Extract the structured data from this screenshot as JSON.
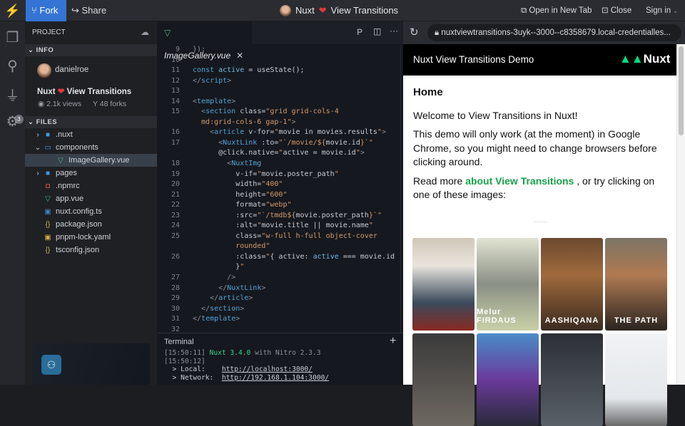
{
  "topbar": {
    "fork": "Fork",
    "share": "Share",
    "title": "Nuxt",
    "title_suffix": "View Transitions",
    "open_new_tab": "Open in New Tab",
    "close": "Close",
    "sign_in": "Sign in"
  },
  "activity": {
    "badge": "3"
  },
  "sidebar": {
    "project": "PROJECT",
    "info": "INFO",
    "user": "danielroe",
    "project_name": "Nuxt",
    "project_name_suffix": "View Transitions",
    "views": "2.1k views",
    "forks": "48 forks",
    "files_header": "FILES",
    "files": [
      {
        "name": ".nuxt",
        "icon": "folder-icon",
        "chev": "›"
      },
      {
        "name": "components",
        "icon": "folder-open-icon",
        "chev": "⌄"
      },
      {
        "name": "ImageGallery.vue",
        "icon": "vue-icon",
        "chev": ""
      },
      {
        "name": "pages",
        "icon": "folder-icon",
        "chev": "›"
      },
      {
        "name": ".npmrc",
        "icon": "npm-icon",
        "chev": ""
      },
      {
        "name": "app.vue",
        "icon": "vue-icon",
        "chev": ""
      },
      {
        "name": "nuxt.config.ts",
        "icon": "typescript-icon",
        "chev": ""
      },
      {
        "name": "package.json",
        "icon": "json-icon",
        "chev": ""
      },
      {
        "name": "pnpm-lock.yaml",
        "icon": "yaml-icon",
        "chev": ""
      },
      {
        "name": "tsconfig.json",
        "icon": "json-icon",
        "chev": ""
      }
    ]
  },
  "editor": {
    "tab": "ImageGallery.vue",
    "lines": [
      {
        "n": "9",
        "t": [
          [
            "p",
            "});"
          ]
        ]
      },
      {
        "n": "10",
        "t": []
      },
      {
        "n": "11",
        "t": [
          [
            "kw",
            "const "
          ],
          [
            "var",
            "active"
          ],
          [
            "id",
            " = useState();"
          ]
        ]
      },
      {
        "n": "12",
        "t": [
          [
            "p",
            "</"
          ],
          [
            "tag",
            "script"
          ],
          [
            "p",
            ">"
          ]
        ]
      },
      {
        "n": "13",
        "t": []
      },
      {
        "n": "14",
        "t": [
          [
            "p",
            "<"
          ],
          [
            "tag",
            "template"
          ],
          [
            "p",
            ">"
          ]
        ]
      },
      {
        "n": "15",
        "t": [
          [
            "p",
            "  <"
          ],
          [
            "tag",
            "section "
          ],
          [
            "attr",
            "class="
          ],
          [
            "str",
            "\"grid grid-cols-4"
          ]
        ]
      },
      {
        "n": "",
        "t": [
          [
            "str",
            "  md:grid-cols-6 gap-1\""
          ],
          [
            "p",
            ">"
          ]
        ]
      },
      {
        "n": "16",
        "t": [
          [
            "p",
            "    <"
          ],
          [
            "tag",
            "article "
          ],
          [
            "attr",
            "v-for="
          ],
          [
            "str",
            "\""
          ],
          [
            "id",
            "movie in movies.results"
          ],
          [
            "str",
            "\""
          ],
          [
            "p",
            ">"
          ]
        ]
      },
      {
        "n": "17",
        "t": [
          [
            "p",
            "      <"
          ],
          [
            "tag",
            "NuxtLink "
          ],
          [
            "attr",
            ":to="
          ],
          [
            "str",
            "\"`/movie/${"
          ],
          [
            "id",
            "movie.id"
          ],
          [
            "str",
            "}`\""
          ]
        ]
      },
      {
        "n": "",
        "t": [
          [
            "attr",
            "      @click.native="
          ],
          [
            "str",
            "\""
          ],
          [
            "id",
            "active = movie.id"
          ],
          [
            "str",
            "\""
          ],
          [
            "p",
            ">"
          ]
        ]
      },
      {
        "n": "18",
        "t": [
          [
            "p",
            "        <"
          ],
          [
            "tag",
            "NuxtImg"
          ]
        ]
      },
      {
        "n": "19",
        "t": [
          [
            "attr",
            "          v-if="
          ],
          [
            "str",
            "\""
          ],
          [
            "id",
            "movie.poster_path"
          ],
          [
            "str",
            "\""
          ]
        ]
      },
      {
        "n": "20",
        "t": [
          [
            "attr",
            "          width="
          ],
          [
            "str",
            "\"400\""
          ]
        ]
      },
      {
        "n": "21",
        "t": [
          [
            "attr",
            "          height="
          ],
          [
            "str",
            "\"600\""
          ]
        ]
      },
      {
        "n": "22",
        "t": [
          [
            "attr",
            "          format="
          ],
          [
            "str",
            "\"webp\""
          ]
        ]
      },
      {
        "n": "23",
        "t": [
          [
            "attr",
            "          :src="
          ],
          [
            "str",
            "\"`/tmdb${"
          ],
          [
            "id",
            "movie.poster_path"
          ],
          [
            "str",
            "}`\""
          ]
        ]
      },
      {
        "n": "24",
        "t": [
          [
            "attr",
            "          :alt="
          ],
          [
            "str",
            "\""
          ],
          [
            "id",
            "movie.title || movie.name"
          ],
          [
            "str",
            "\""
          ]
        ]
      },
      {
        "n": "25",
        "t": [
          [
            "attr",
            "          class="
          ],
          [
            "str",
            "\"w-full h-full object-cover"
          ]
        ]
      },
      {
        "n": "",
        "t": [
          [
            "str",
            "          rounded\""
          ]
        ]
      },
      {
        "n": "26",
        "t": [
          [
            "attr",
            "          :class="
          ],
          [
            "str",
            "\""
          ],
          [
            "id",
            "{ active: "
          ],
          [
            "var",
            "active"
          ],
          [
            "id",
            " === movie.id"
          ]
        ]
      },
      {
        "n": "",
        "t": [
          [
            "id",
            "          }"
          ],
          [
            "str",
            "\""
          ]
        ]
      },
      {
        "n": "27",
        "t": [
          [
            "p",
            "        />"
          ]
        ]
      },
      {
        "n": "28",
        "t": [
          [
            "p",
            "      </"
          ],
          [
            "tag",
            "NuxtLink"
          ],
          [
            "p",
            ">"
          ]
        ]
      },
      {
        "n": "29",
        "t": [
          [
            "p",
            "    </"
          ],
          [
            "tag",
            "article"
          ],
          [
            "p",
            ">"
          ]
        ]
      },
      {
        "n": "30",
        "t": [
          [
            "p",
            "  </"
          ],
          [
            "tag",
            "section"
          ],
          [
            "p",
            ">"
          ]
        ]
      },
      {
        "n": "31",
        "t": [
          [
            "p",
            "</"
          ],
          [
            "tag",
            "template"
          ],
          [
            "p",
            ">"
          ]
        ]
      },
      {
        "n": "32",
        "t": []
      }
    ]
  },
  "terminal": {
    "title": "Terminal",
    "time1": "[15:50:11]",
    "nuxt": "Nuxt 3.4.0",
    "nitro": " with Nitro 2.3.3",
    "time2": "[15:50:12]",
    "local_label": "  > Local:    ",
    "local_url": "http://localhost:3000/",
    "network_label": "  > Network:  ",
    "network_url": "http://192.168.1.104:3000/"
  },
  "preview": {
    "url": "nuxtviewtransitions-3uyk--3000--c8358679.local-credentialles...",
    "header": "Nuxt View Transitions Demo",
    "logo": "Nuxt",
    "heading": "Home",
    "p1": "Welcome to View Transitions in Nuxt!",
    "p2": "This demo will only work (at the moment) in Google Chrome, so you might need to change browsers before clicking around.",
    "p3_pre": "Read more ",
    "p3_link": "about View Transitions",
    "p3_post": " , or try clicking on one of these images:",
    "posters": [
      {
        "title": "",
        "bg": "linear-gradient(#cfc7b8,#e9e4dc 30%,#3a4a5c 70%,#8a2a22)"
      },
      {
        "title": "Melur FIRDAUS",
        "bg": "linear-gradient(#e2e4d2,#8a8f84 50%,#c8d0a8)"
      },
      {
        "title": "AASHIQANA",
        "bg": "linear-gradient(#6b4a30,#a06a3c 40%,#3a2a20)"
      },
      {
        "title": "THE PATH",
        "bg": "linear-gradient(#7d7466,#b07a52 40%,#2a2420)"
      },
      {
        "title": "",
        "bg": "linear-gradient(#3a3a3a,#6e6862)"
      },
      {
        "title": "",
        "bg": "linear-gradient(#4a8cc8,#6a3a9a 50%,#2a2a3a)"
      },
      {
        "title": "",
        "bg": "linear-gradient(#2c3036,#5a6068)"
      },
      {
        "title": "",
        "bg": "linear-gradient(#f0f2f4,#e4e8ec 70%,#6a6a6a)"
      }
    ]
  },
  "colors": {
    "accent": "#3574d4",
    "nuxt_green": "#00dc82",
    "link_green": "#16a34a"
  }
}
